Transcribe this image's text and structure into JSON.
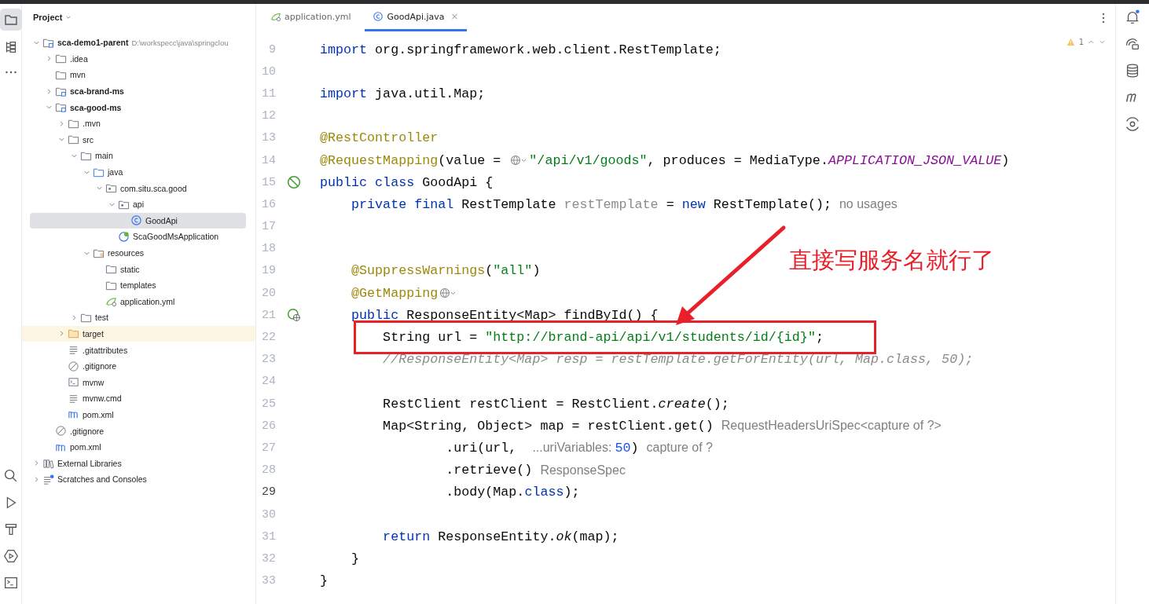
{
  "project_panel": {
    "title": "Project",
    "tree": [
      {
        "label": "sca-demo1-parent",
        "hint": "D:\\workspecc\\java\\springclou",
        "kind": "module",
        "expanded": true,
        "selected": false,
        "children": [
          {
            "label": ".idea",
            "kind": "folder",
            "expanded": false,
            "selected": false
          },
          {
            "label": "mvn",
            "kind": "folder",
            "selected": false
          },
          {
            "label": "sca-brand-ms",
            "kind": "module",
            "expanded": false,
            "selected": false
          },
          {
            "label": "sca-good-ms",
            "kind": "module",
            "expanded": true,
            "selected": false,
            "children": [
              {
                "label": ".mvn",
                "kind": "folder",
                "expanded": false,
                "selected": false
              },
              {
                "label": "src",
                "kind": "folder",
                "expanded": true,
                "selected": false,
                "children": [
                  {
                    "label": "main",
                    "kind": "folder",
                    "expanded": true,
                    "selected": false,
                    "children": [
                      {
                        "label": "java",
                        "kind": "source",
                        "expanded": true,
                        "selected": false,
                        "children": [
                          {
                            "label": "com.situ.sca.good",
                            "kind": "package",
                            "expanded": true,
                            "selected": false,
                            "children": [
                              {
                                "label": "api",
                                "kind": "package",
                                "expanded": true,
                                "selected": false,
                                "children": [
                                  {
                                    "label": "GoodApi",
                                    "kind": "class",
                                    "selected": true
                                  }
                                ]
                              },
                              {
                                "label": "ScaGoodMsApplication",
                                "kind": "spring",
                                "selected": false
                              }
                            ]
                          }
                        ]
                      },
                      {
                        "label": "resources",
                        "kind": "resources",
                        "expanded": true,
                        "selected": false,
                        "children": [
                          {
                            "label": "static",
                            "kind": "folder",
                            "selected": false
                          },
                          {
                            "label": "templates",
                            "kind": "folder",
                            "selected": false
                          },
                          {
                            "label": "application.yml",
                            "kind": "yaml",
                            "selected": false
                          }
                        ]
                      }
                    ]
                  },
                  {
                    "label": "test",
                    "kind": "folder",
                    "expanded": false,
                    "selected": false
                  }
                ]
              },
              {
                "label": "target",
                "kind": "excluded",
                "expanded": false,
                "selected": false
              },
              {
                "label": ".gitattributes",
                "kind": "text",
                "selected": false
              },
              {
                "label": ".gitignore",
                "kind": "ignore",
                "selected": false
              },
              {
                "label": "mvnw",
                "kind": "shell",
                "selected": false
              },
              {
                "label": "mvnw.cmd",
                "kind": "text",
                "selected": false
              },
              {
                "label": "pom.xml",
                "kind": "maven",
                "selected": false
              }
            ]
          },
          {
            "label": ".gitignore",
            "kind": "ignore",
            "selected": false
          },
          {
            "label": "pom.xml",
            "kind": "maven",
            "selected": false
          }
        ]
      },
      {
        "label": "External Libraries",
        "kind": "libraries",
        "expanded": false,
        "selected": false
      },
      {
        "label": "Scratches and Consoles",
        "kind": "scratches",
        "expanded": false,
        "selected": false
      }
    ]
  },
  "tabs": [
    {
      "label": "application.yml",
      "kind": "yaml",
      "selected": false
    },
    {
      "label": "GoodApi.java",
      "kind": "class",
      "selected": true,
      "close": "×"
    }
  ],
  "inspections": {
    "warnings": "1"
  },
  "code": {
    "lines": [
      {
        "number": "9",
        "kind": "plain",
        "current": false,
        "tokens": [
          {
            "kind": "keyword",
            "text": "import"
          },
          {
            "kind": "plain",
            "text": " org.springframework.web.client.RestTemplate;"
          }
        ]
      },
      {
        "number": "10",
        "kind": "plain",
        "current": false
      },
      {
        "number": "11",
        "kind": "plain",
        "current": false,
        "tokens": [
          {
            "kind": "keyword",
            "text": "import"
          },
          {
            "kind": "plain",
            "text": " java.util.Map;"
          }
        ]
      },
      {
        "number": "12",
        "kind": "plain",
        "current": false
      },
      {
        "number": "13",
        "kind": "plain",
        "current": false,
        "tokens": [
          {
            "kind": "annotation",
            "text": "@RestController"
          }
        ]
      },
      {
        "number": "14",
        "kind": "plain",
        "current": false,
        "tokens": [
          {
            "kind": "annotation",
            "text": "@RequestMapping"
          },
          {
            "kind": "plain",
            "text": "(value = "
          },
          {
            "kind": "globe"
          },
          {
            "kind": "string",
            "text": "\"/api/v1/goods\""
          },
          {
            "kind": "plain",
            "text": ", produces = MediaType."
          },
          {
            "kind": "constant",
            "text": "APPLICATION_JSON_VALUE"
          },
          {
            "kind": "plain",
            "text": ")"
          }
        ]
      },
      {
        "number": "15",
        "kind": "bean",
        "current": false,
        "tokens": [
          {
            "kind": "keyword",
            "text": "public class"
          },
          {
            "kind": "plain",
            "text": " GoodApi {"
          }
        ]
      },
      {
        "number": "16",
        "kind": "plain",
        "current": false,
        "tokens": [
          {
            "kind": "keyword",
            "text": "    private final"
          },
          {
            "kind": "plain",
            "text": " RestTemplate "
          },
          {
            "kind": "unused",
            "text": "restTemplate"
          },
          {
            "kind": "plain",
            "text": " = "
          },
          {
            "kind": "keyword",
            "text": "new"
          },
          {
            "kind": "plain",
            "text": " RestTemplate();"
          },
          {
            "kind": "hint",
            "text": "no usages"
          }
        ]
      },
      {
        "number": "17",
        "kind": "plain",
        "current": false
      },
      {
        "number": "18",
        "kind": "plain",
        "current": false
      },
      {
        "number": "19",
        "kind": "plain",
        "current": false,
        "tokens": [
          {
            "kind": "annotation",
            "text": "    @SuppressWarnings"
          },
          {
            "kind": "plain",
            "text": "("
          },
          {
            "kind": "string",
            "text": "\"all\""
          },
          {
            "kind": "plain",
            "text": ")"
          }
        ]
      },
      {
        "number": "20",
        "kind": "plain",
        "current": false,
        "tokens": [
          {
            "kind": "annotation",
            "text": "    @GetMapping"
          },
          {
            "kind": "globe"
          }
        ]
      },
      {
        "number": "21",
        "kind": "web",
        "current": false,
        "tokens": [
          {
            "kind": "keyword",
            "text": "    public"
          },
          {
            "kind": "plain",
            "text": " ResponseEntity<Map> findById() {"
          }
        ]
      },
      {
        "number": "22",
        "kind": "plain",
        "current": false,
        "tokens": [
          {
            "kind": "plain",
            "text": "        String url = "
          },
          {
            "kind": "string",
            "text": "\"http://brand-api/api/v1/students/id/{id}\""
          },
          {
            "kind": "plain",
            "text": ";"
          }
        ]
      },
      {
        "number": "23",
        "kind": "plain",
        "current": false,
        "tokens": [
          {
            "kind": "comment",
            "text": "        //ResponseEntity<Map> resp = restTemplate.getForEntity(url, Map.class, 50);"
          }
        ]
      },
      {
        "number": "24",
        "kind": "plain",
        "current": false
      },
      {
        "number": "25",
        "kind": "plain",
        "current": false,
        "tokens": [
          {
            "kind": "plain",
            "text": "        RestClient restClient = RestClient."
          },
          {
            "kind": "italic",
            "text": "create"
          },
          {
            "kind": "plain",
            "text": "();"
          }
        ]
      },
      {
        "number": "26",
        "kind": "plain",
        "current": false,
        "tokens": [
          {
            "kind": "plain",
            "text": "        Map<String, Object> map = restClient.get()"
          },
          {
            "kind": "hint",
            "text": "RequestHeadersUriSpec<capture of ?>"
          }
        ]
      },
      {
        "number": "27",
        "kind": "plain",
        "current": false,
        "tokens": [
          {
            "kind": "plain",
            "text": "                .uri(url, "
          },
          {
            "kind": "hint",
            "text": "...uriVariables:"
          },
          {
            "kind": "number",
            "text": "50"
          },
          {
            "kind": "plain",
            "text": ")"
          },
          {
            "kind": "hint",
            "text": "capture of ?"
          }
        ]
      },
      {
        "number": "28",
        "kind": "plain",
        "current": false,
        "tokens": [
          {
            "kind": "plain",
            "text": "                .retrieve()"
          },
          {
            "kind": "hint",
            "text": "ResponseSpec"
          }
        ]
      },
      {
        "number": "29",
        "kind": "plain",
        "current": true,
        "tokens": [
          {
            "kind": "plain",
            "text": "                .body(Map."
          },
          {
            "kind": "keyword",
            "text": "class"
          },
          {
            "kind": "plain",
            "text": ");"
          }
        ]
      },
      {
        "number": "30",
        "kind": "plain",
        "current": false
      },
      {
        "number": "31",
        "kind": "plain",
        "current": false,
        "tokens": [
          {
            "kind": "keyword",
            "text": "        return"
          },
          {
            "kind": "plain",
            "text": " ResponseEntity."
          },
          {
            "kind": "italic",
            "text": "ok"
          },
          {
            "kind": "plain",
            "text": "(map);"
          }
        ]
      },
      {
        "number": "32",
        "kind": "plain",
        "current": false,
        "tokens": [
          {
            "kind": "plain",
            "text": "    }"
          }
        ]
      },
      {
        "number": "33",
        "kind": "plain",
        "current": false,
        "tokens": [
          {
            "kind": "plain",
            "text": "}"
          }
        ]
      }
    ]
  },
  "annotation": {
    "note": "直接写服务名就行了"
  }
}
